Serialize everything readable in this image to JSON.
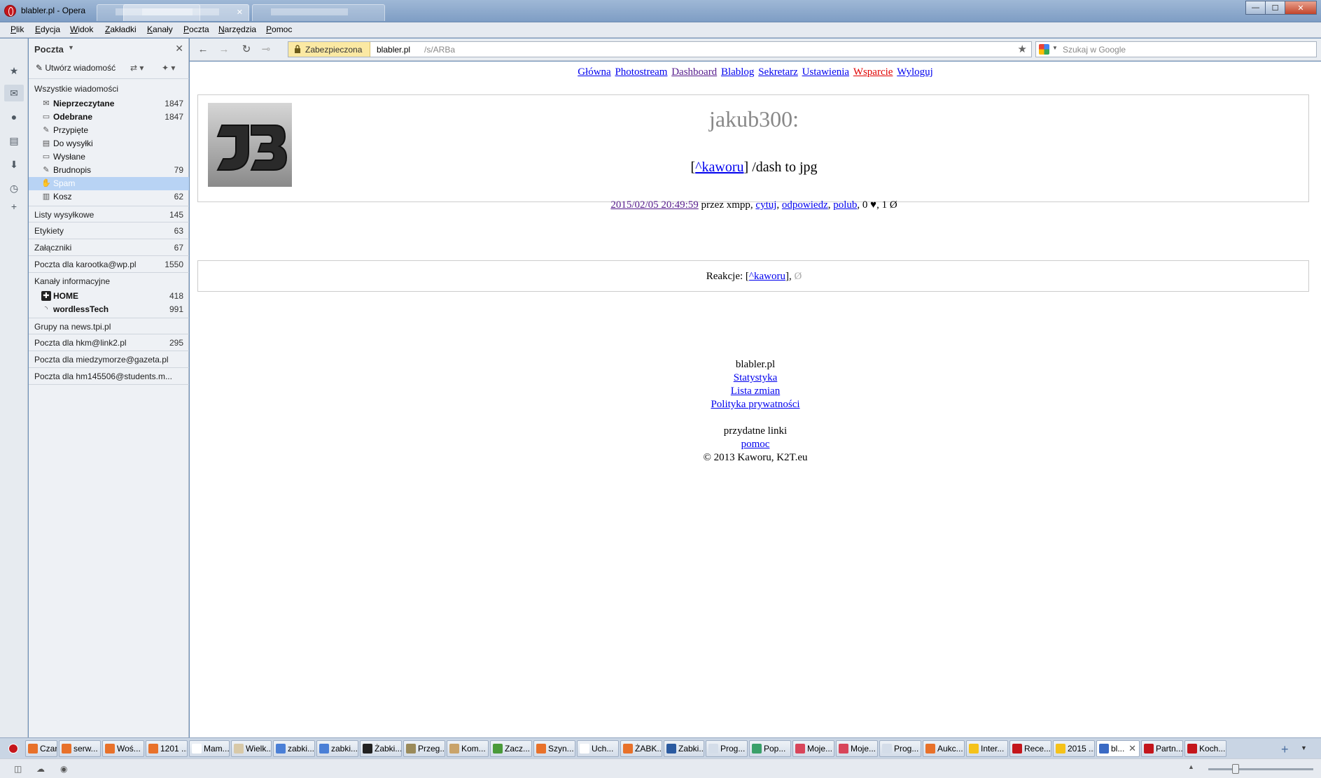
{
  "window": {
    "title": "blabler.pl - Opera",
    "controls": {
      "minimize": "—",
      "maximize": "☐",
      "close": "✕"
    }
  },
  "menubar": [
    "Plik",
    "Edycja",
    "Widok",
    "Zakładki",
    "Kanały",
    "Poczta",
    "Narzędzia",
    "Pomoc"
  ],
  "mail": {
    "title": "Poczta",
    "compose": "Utwórz wiadomość",
    "all_messages": "Wszystkie wiadomości",
    "folders": [
      {
        "label": "Nieprzeczytane",
        "count": "1847",
        "bold": true,
        "icon": "✉"
      },
      {
        "label": "Odebrane",
        "count": "1847",
        "bold": true,
        "icon": "▭"
      },
      {
        "label": "Przypięte",
        "count": "",
        "bold": false,
        "icon": "✎"
      },
      {
        "label": "Do wysyłki",
        "count": "",
        "bold": false,
        "icon": "▤"
      },
      {
        "label": "Wysłane",
        "count": "",
        "bold": false,
        "icon": "▭"
      },
      {
        "label": "Brudnopis",
        "count": "79",
        "bold": false,
        "icon": "✎"
      },
      {
        "label": "Spam",
        "count": "",
        "bold": false,
        "icon": "✋",
        "selected": true
      },
      {
        "label": "Kosz",
        "count": "62",
        "bold": false,
        "icon": "🗑"
      }
    ],
    "sections": [
      {
        "label": "Listy wysyłkowe",
        "count": "145"
      },
      {
        "label": "Etykiety",
        "count": "63"
      },
      {
        "label": "Załączniki",
        "count": "67"
      },
      {
        "label": "Poczta dla karootka@wp.pl",
        "count": "1550"
      },
      {
        "label": "Kanały informacyjne",
        "count": ""
      }
    ],
    "feeds": [
      {
        "label": "HOME",
        "count": "418",
        "icon": "✚"
      },
      {
        "label": "wordlessTech",
        "count": "991",
        "icon": "◝"
      }
    ],
    "accounts": [
      {
        "label": "Grupy na news.tpi.pl",
        "count": ""
      },
      {
        "label": "Poczta dla hkm@link2.pl",
        "count": "295"
      },
      {
        "label": "Poczta dla miedzymorze@gazeta.pl",
        "count": ""
      },
      {
        "label": "Poczta dla hm145506@students.m...",
        "count": ""
      }
    ]
  },
  "address": {
    "secure_label": "Zabezpieczona",
    "host": "blabler.pl",
    "path": "/s/ARBa",
    "search_placeholder": "Szukaj w Google"
  },
  "page": {
    "nav": [
      {
        "label": "Główna",
        "style": "link"
      },
      {
        "label": "Photostream",
        "style": "link"
      },
      {
        "label": "Dashboard",
        "style": "visited"
      },
      {
        "label": "Blablog",
        "style": "link"
      },
      {
        "label": "Sekretarz",
        "style": "link"
      },
      {
        "label": "Ustawienia",
        "style": "link"
      },
      {
        "label": "Wsparcie",
        "style": "red"
      },
      {
        "label": "Wyloguj",
        "style": "link"
      }
    ],
    "post": {
      "author": "jakub300:",
      "mention": "^kaworu",
      "text": "/dash to jpg",
      "date": "2015/02/05 20:49:59",
      "via": "przez xmpp,",
      "cite": "cytuj",
      "reply": "odpowiedz",
      "like": "polub",
      "stats": "0 ♥, 1 Ø"
    },
    "reactions": {
      "label": "Reakcje:",
      "user": "^kaworu",
      "empty": "Ø"
    },
    "footer": {
      "site": "blabler.pl",
      "links": [
        "Statystyka",
        "Lista zmian",
        "Polityka prywatności"
      ],
      "useful": "przydatne linki",
      "help": "pomoc",
      "copyright": "© 2013 Kaworu, K2T.eu"
    }
  },
  "tabs": [
    {
      "label": "Czary...",
      "color": "#e8712a"
    },
    {
      "label": "serw...",
      "color": "#e8712a"
    },
    {
      "label": "Woś...",
      "color": "#e8712a"
    },
    {
      "label": "1201 ...",
      "color": "#e8712a"
    },
    {
      "label": "Mam...",
      "color": "#ffffff"
    },
    {
      "label": "Wielk...",
      "color": "#d8c9a8"
    },
    {
      "label": "zabki...",
      "color": "#4a7fd6"
    },
    {
      "label": "zabki...",
      "color": "#4a7fd6"
    },
    {
      "label": "Żabki...",
      "color": "#222222"
    },
    {
      "label": "Przeg...",
      "color": "#9a8a5a"
    },
    {
      "label": "Kom...",
      "color": "#c9a36a"
    },
    {
      "label": "Zacz...",
      "color": "#4a9a3a"
    },
    {
      "label": "Szyn...",
      "color": "#e8712a"
    },
    {
      "label": "Uch...",
      "color": "#ffffff"
    },
    {
      "label": "ŻABK...",
      "color": "#e8712a"
    },
    {
      "label": "Zabki...",
      "color": "#2a5aa0"
    },
    {
      "label": "Prog...",
      "color": "#d4dde9"
    },
    {
      "label": "Pop...",
      "color": "#3aa06a"
    },
    {
      "label": "Moje...",
      "color": "#d8455a"
    },
    {
      "label": "Moje...",
      "color": "#d8455a"
    },
    {
      "label": "Prog...",
      "color": "#d4dde9"
    },
    {
      "label": "Aukc...",
      "color": "#e8712a"
    },
    {
      "label": "Inter...",
      "color": "#f5c21a"
    },
    {
      "label": "Rece...",
      "color": "#c4161c"
    },
    {
      "label": "2015 ...",
      "color": "#f5c21a"
    },
    {
      "label": "bl...",
      "color": "#3a6ac4",
      "active": true
    },
    {
      "label": "Partn...",
      "color": "#c4161c"
    },
    {
      "label": "Koch...",
      "color": "#c4161c"
    }
  ]
}
